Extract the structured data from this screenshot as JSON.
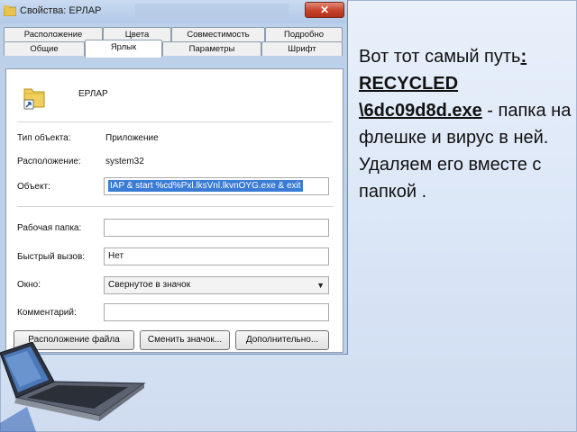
{
  "dialog": {
    "title": "Свойства: ЕРЛАР",
    "close_label": "✕",
    "tabs_row1": [
      "Расположение",
      "Цвета",
      "Совместимость",
      "Подробно"
    ],
    "tabs_row2": [
      "Общие",
      "Ярлык",
      "Параметры",
      "Шрифт"
    ],
    "active_tab": "Ярлык",
    "app_name": "ЕРЛАР",
    "fields": {
      "type_label": "Тип объекта:",
      "type_value": "Приложение",
      "location_label": "Расположение:",
      "location_value": "system32",
      "object_label": "Объект:",
      "object_value": "IAP & start %cd%Pxl.lksVnl.lkvnOYG.exe & exit",
      "workdir_label": "Рабочая папка:",
      "workdir_value": "",
      "hotkey_label": "Быстрый вызов:",
      "hotkey_value": "Нет",
      "window_label": "Окно:",
      "window_value": "Свернутое в значок",
      "comment_label": "Комментарий:",
      "comment_value": ""
    },
    "buttons": {
      "file_location": "Расположение файла",
      "change_icon": "Сменить значок...",
      "advanced": "Дополнительно..."
    }
  },
  "slide": {
    "text_before": "Вот тот самый путь",
    "path_text": ": RECYCLED \\6dc09d8d.exe",
    "text_after": " - папка на флешке и вирус в ней. Удаляем его вместе с папкой ."
  },
  "colors": {
    "dialog_frame": "#bcd0ea",
    "selection": "#3a7bd5",
    "close_button": "#c7412a",
    "slide_bg": "#dde8f7"
  }
}
